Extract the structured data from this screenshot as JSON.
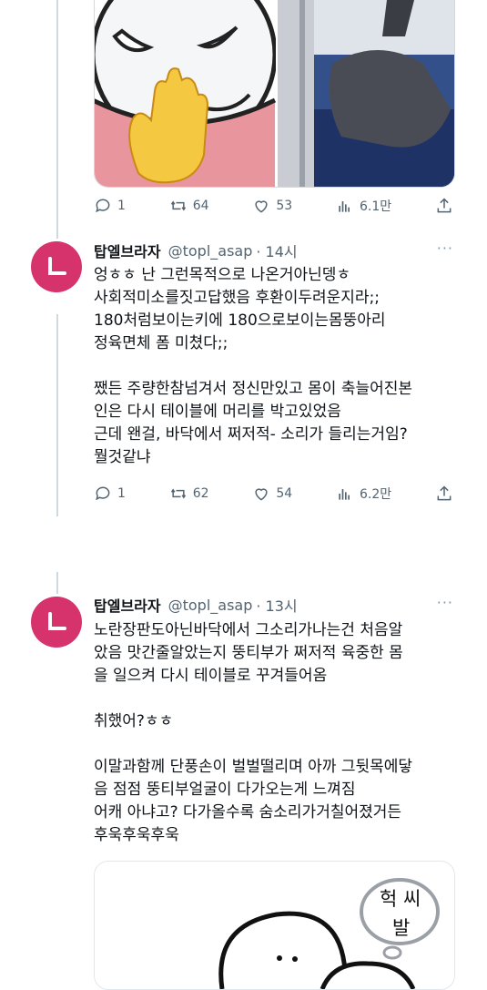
{
  "tweet1": {
    "actions": {
      "replies": "1",
      "retweets": "64",
      "likes": "53",
      "views": "6.1만"
    }
  },
  "tweet2": {
    "avatar_letter": "ㄴ",
    "name": "탑엘브라자",
    "handle": "@topl_asap",
    "time": "· 14시",
    "more": "···",
    "lines": [
      "엉ㅎㅎ 난 그런목적으로 나온거아닌뎅ㅎ",
      "사회적미소를짓고답했음 후환이두려운지라;;",
      "180처럼보이는키에 180으로보이는몸뚱아리",
      "정육면체 폼 미쳤다;;",
      "",
      "쨌든 주량한참넘겨서 정신만있고 몸이 축늘어진본",
      "인은 다시 테이블에 머리를 박고있었음",
      "근데 왠걸, 바닥에서 쩌저적- 소리가 들리는거임?",
      "뭘것같냐"
    ],
    "actions": {
      "replies": "1",
      "retweets": "62",
      "likes": "54",
      "views": "6.2만"
    }
  },
  "tweet3": {
    "avatar_letter": "ㄴ",
    "name": "탑엘브라자",
    "handle": "@topl_asap",
    "time": "· 13시",
    "more": "···",
    "lines": [
      "노란장판도아닌바닥에서 그소리가나는건 처음알",
      "았음 맛간줄알았는지 뚱티부가 쩌저적 육중한 몸",
      "을 일으켜 다시 테이블로 꾸겨들어옴",
      "",
      "취했어?ㅎㅎ",
      "",
      "이말과함께 단풍손이 벌벌떨리며 아까 그뒷목에닿",
      "음 점점 뚱티부얼굴이 다가오는게 느껴짐",
      "어캐 아냐고? 다가올수록 숨소리가거칠어졌거든",
      "후욱후욱후욱"
    ],
    "sketch": {
      "bubble_line1": "헉 씨",
      "bubble_line2": "발"
    }
  },
  "colors": {
    "avatar": "#d6336c",
    "muted": "#536471",
    "divider": "#cfd9de"
  }
}
